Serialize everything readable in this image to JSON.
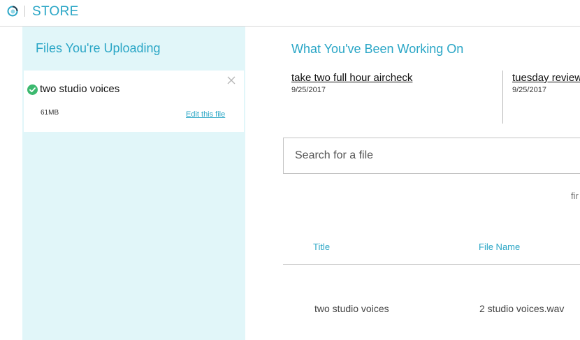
{
  "header": {
    "app_title": "STORE",
    "logo_icon": "circle-logo-icon"
  },
  "sidebar": {
    "title": "Files You're Uploading",
    "uploads": [
      {
        "name": "two studio voices",
        "size": "61MB",
        "edit_label": "Edit this file",
        "status_icon": "check-circle-icon",
        "remove_icon": "close-icon"
      }
    ]
  },
  "main": {
    "title": "What You've Been Working On",
    "recent": [
      {
        "name": "take two full hour aircheck",
        "date": "9/25/2017"
      },
      {
        "name": "tuesday review",
        "date": "9/25/2017"
      }
    ],
    "search": {
      "placeholder": "Search for a file"
    },
    "clipped_label": "fir",
    "table": {
      "columns": [
        "Title",
        "File Name"
      ],
      "rows": [
        [
          "two studio voices",
          "2 studio voices.wav"
        ]
      ]
    }
  },
  "colors": {
    "accent": "#2aa6c6",
    "sidebar_bg": "#e1f6f9",
    "success": "#3cb96f"
  }
}
